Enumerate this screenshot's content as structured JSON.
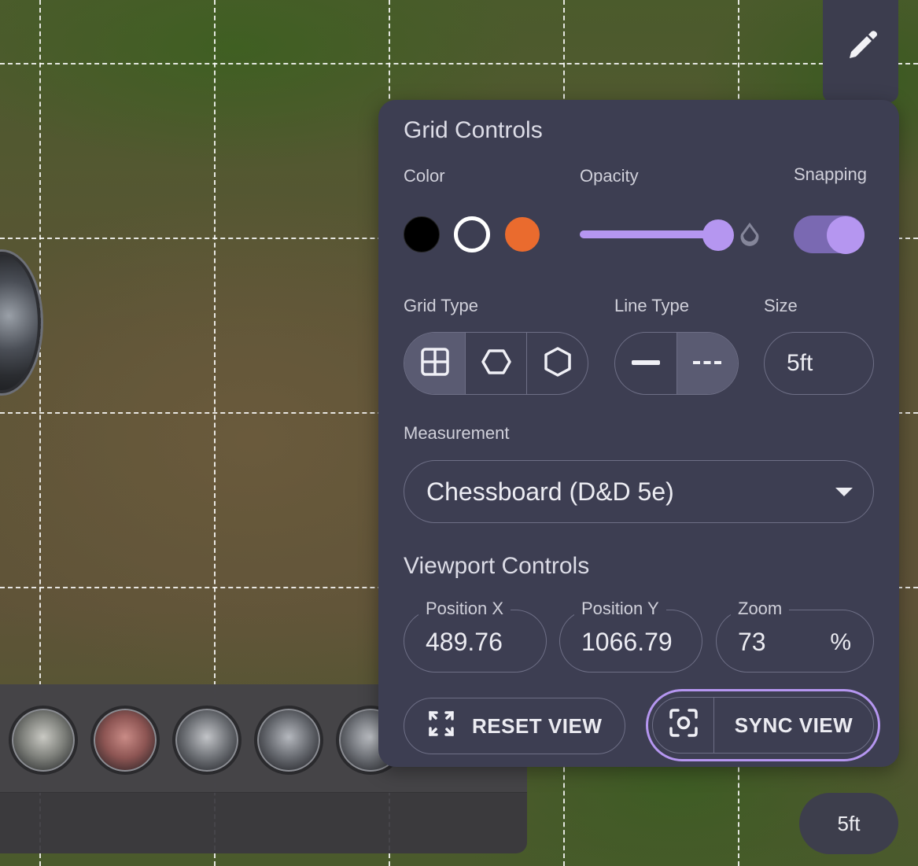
{
  "panel": {
    "title": "Grid Controls",
    "color_label": "Color",
    "opacity_label": "Opacity",
    "snapping_label": "Snapping",
    "colors": [
      {
        "name": "black",
        "hex": "#000000",
        "selected": false
      },
      {
        "name": "white",
        "hex": "#ffffff",
        "selected": true
      },
      {
        "name": "orange",
        "hex": "#ea6b2e",
        "selected": false
      }
    ],
    "opacity_value": 0.9,
    "snapping_on": true,
    "grid_type_label": "Grid Type",
    "grid_types": [
      {
        "name": "square",
        "icon": "grid-square-icon",
        "active": true
      },
      {
        "name": "hex-horizontal",
        "icon": "hex-flat-icon",
        "active": false
      },
      {
        "name": "hex-vertical",
        "icon": "hex-pointy-icon",
        "active": false
      }
    ],
    "line_type_label": "Line Type",
    "line_types": [
      {
        "name": "solid",
        "icon": "solid-line-icon",
        "active": false
      },
      {
        "name": "dashed",
        "icon": "dashed-line-icon",
        "active": true
      }
    ],
    "size_label": "Size",
    "size_value": "5ft",
    "measurement_label": "Measurement",
    "measurement_value": "Chessboard (D&D 5e)",
    "viewport_title": "Viewport Controls",
    "position_x_label": "Position X",
    "position_x_value": "489.76",
    "position_y_label": "Position Y",
    "position_y_value": "1066.79",
    "zoom_label": "Zoom",
    "zoom_value": "73",
    "zoom_unit": "%",
    "reset_view_label": "RESET VIEW",
    "sync_view_label": "SYNC VIEW"
  },
  "toolbar": {
    "tool_icon": "pencil-icon"
  },
  "size_indicator": "5ft",
  "token_tray": {
    "tokens": [
      "wolf-token",
      "dragon-token",
      "hammer-token",
      "knight-helmet-token",
      "shield-token"
    ]
  },
  "accent_color": "#b596f0"
}
